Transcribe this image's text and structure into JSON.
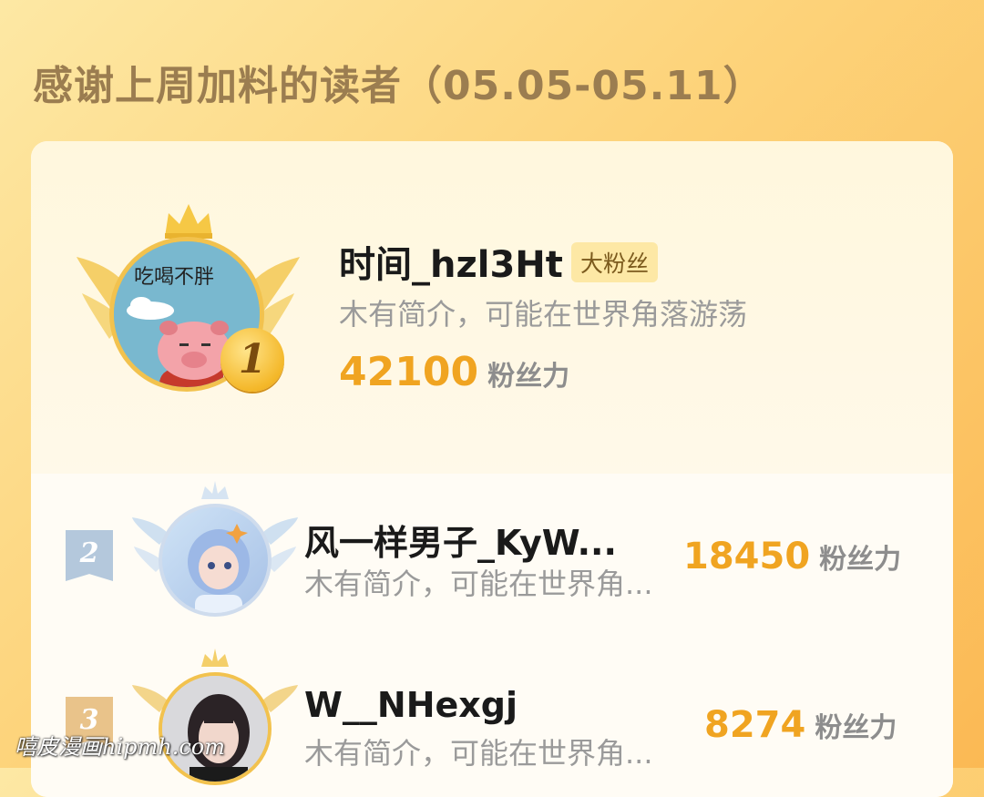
{
  "page": {
    "title": "感谢上周加料的读者（05.05-05.11）"
  },
  "colors": {
    "accent": "#f0a421",
    "background_start": "#fde8a4",
    "background_end": "#fbb954"
  },
  "rankings": [
    {
      "rank": "1",
      "name": "时间_hzl3Ht",
      "badge": "大粉丝",
      "bio": "木有简介，可能在世界角落游荡",
      "score": "42100",
      "unit": "粉丝力",
      "avatar_text": "吃喝不胖"
    },
    {
      "rank": "2",
      "name": "风一样男子_KyW...",
      "bio": "木有简介，可能在世界角...",
      "score": "18450",
      "unit": "粉丝力"
    },
    {
      "rank": "3",
      "name": "W__NHexgj",
      "bio": "木有简介，可能在世界角...",
      "score": "8274",
      "unit": "粉丝力"
    }
  ],
  "watermark": "嘻皮漫画hipmh.com",
  "icons": [
    "crown-icon",
    "wing-icon",
    "rank-medal-icon"
  ]
}
